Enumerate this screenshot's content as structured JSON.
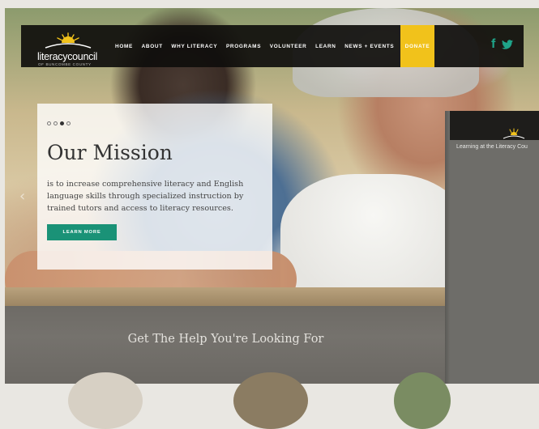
{
  "header": {
    "logo": {
      "name": "literacycouncil",
      "tagline": "OF BUNCOMBE COUNTY"
    },
    "nav_items": [
      "HOME",
      "ABOUT",
      "WHY LITERACY",
      "PROGRAMS",
      "VOLUNTEER",
      "LEARN",
      "NEWS + EVENTS"
    ],
    "donate_label": "DONATE",
    "social": {
      "facebook": "f",
      "twitter": "t"
    },
    "colors": {
      "bar": "#0f0e0c",
      "donate": "#f1c21b",
      "social": "#1fa58a"
    }
  },
  "hero": {
    "slider_dots": 4,
    "active_dot": 3,
    "title": "Our Mission",
    "body": "is to increase comprehensive literacy and English language skills through specialized instruction by trained tutors and access to literacy resources.",
    "button_label": "LEARN MORE",
    "button_color": "#1a9277"
  },
  "help_section": {
    "title": "Get The Help You're Looking For"
  },
  "side_window": {
    "title": "Learning at the Literacy Cou"
  }
}
